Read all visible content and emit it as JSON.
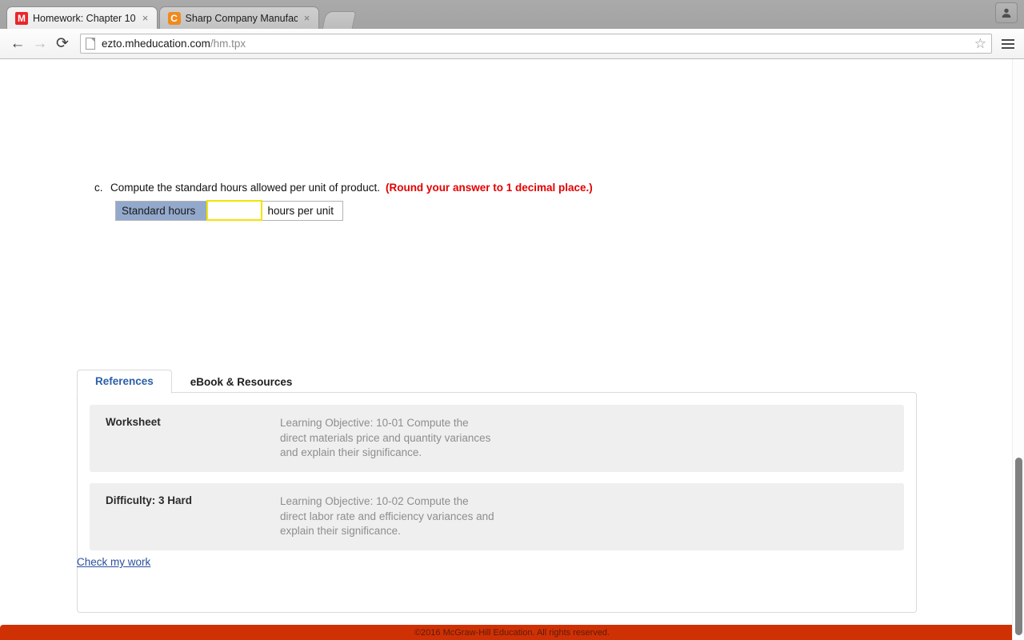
{
  "browser": {
    "tabs": [
      {
        "title": "Homework: Chapter 10",
        "favicon_letter": "M",
        "favicon_name": "mcgraw-hill-favicon",
        "close_label": "×",
        "active": true
      },
      {
        "title": "Sharp Company Manufactu",
        "favicon_letter": "C",
        "favicon_name": "connect-favicon",
        "close_label": "×",
        "active": false
      }
    ],
    "new_tab_label": "",
    "nav": {
      "back": "←",
      "forward": "→",
      "reload": "⟳"
    },
    "omnibox": {
      "url_domain": "ezto.mheducation.com",
      "url_path": "/hm.tpx",
      "placeholder": "Search Google or type URL",
      "star": "☆"
    },
    "profile_icon": "person-icon",
    "menu_icon": "hamburger-menu-icon"
  },
  "question": {
    "letter": "c.",
    "text": "Compute the standard hours allowed per unit of product.",
    "hint": "(Round your answer to 1 decimal place.)"
  },
  "answer_table": {
    "label": "Standard hours",
    "value": "",
    "placeholder": "",
    "unit": "hours per unit"
  },
  "reference_tabs": [
    {
      "label": "References",
      "active": true
    },
    {
      "label": "eBook & Resources",
      "active": false
    }
  ],
  "references": [
    {
      "key": "Worksheet",
      "value": "Learning Objective: 10-01 Compute the direct materials price and quantity variances and explain their significance."
    },
    {
      "key": "Difficulty: 3 Hard",
      "value": "Learning Objective: 10-02 Compute the direct labor rate and efficiency variances and explain their significance."
    }
  ],
  "check_my_work": "Check my work",
  "footer": {
    "copyright": "©2016 McGraw-Hill Education. All rights reserved."
  },
  "colors": {
    "footer_bg": "#cf3105",
    "hint_red": "#e30000",
    "tab_active_blue": "#2b5fa8",
    "label_cell_blue": "#93a9cc",
    "input_highlight_yellow": "#f2e400",
    "link_blue": "#2b4f9e"
  }
}
